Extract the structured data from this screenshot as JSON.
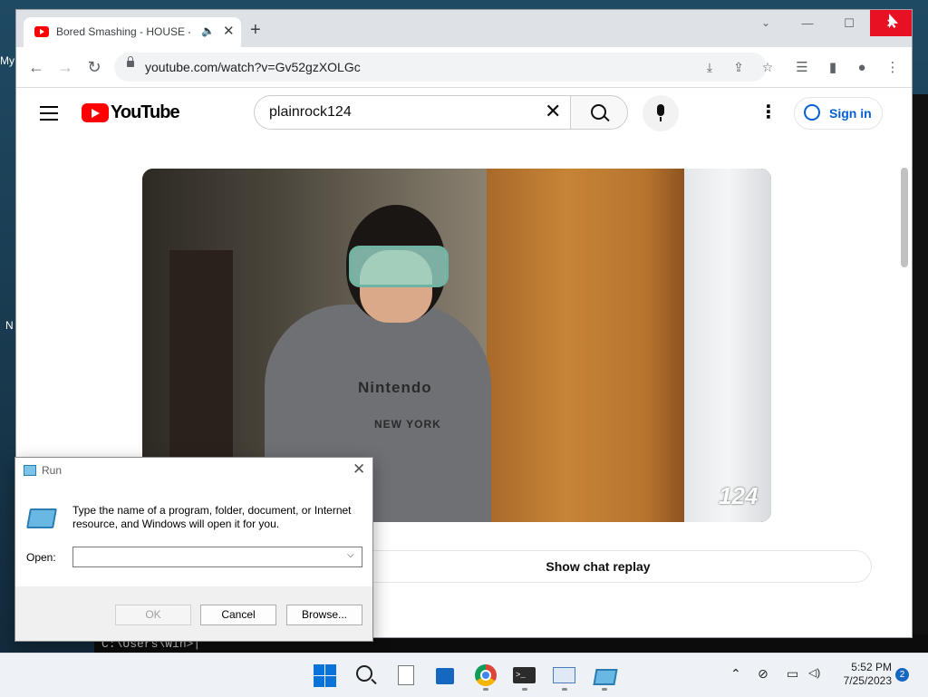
{
  "desktop": {
    "left_labels": [
      "My",
      "N"
    ],
    "terminal_text": "C:\\Users\\Win>|"
  },
  "browser": {
    "tab_title": "Bored Smashing - HOUSE - YouTube",
    "tab_audio_icon": "speaker-icon",
    "tab_close": "✕",
    "newtab": "+",
    "window_controls": {
      "tabsearch": "⌄",
      "minimize": "—",
      "maximize": "☐",
      "close": "✕"
    },
    "nav": {
      "back": "←",
      "forward": "→",
      "reload": "↻"
    },
    "url": "youtube.com/watch?v=Gv52gzXOLGc",
    "omnibox_icons": [
      "install-icon",
      "share-icon",
      "star-icon"
    ],
    "toolbar_icons": [
      "reading-list-icon",
      "side-panel-icon",
      "profile-icon",
      "menu-icon"
    ]
  },
  "youtube": {
    "logo_text": "YouTube",
    "search_value": "plainrock124",
    "clear_symbol": "✕",
    "kebab": "⋮",
    "signin_label": "Sign in",
    "video": {
      "shirt_text": "Nintendo",
      "shirt_sub": "NEW YORK",
      "watermark": "124"
    },
    "chat_replay_label": "Show chat replay"
  },
  "run_dialog": {
    "title": "Run",
    "close": "✕",
    "description": "Type the name of a program, folder, document, or Internet resource, and Windows will open it for you.",
    "open_label": "Open:",
    "open_value": "",
    "buttons": {
      "ok": "OK",
      "cancel": "Cancel",
      "browse": "Browse..."
    }
  },
  "taskbar": {
    "apps": [
      "start-icon",
      "search-icon",
      "file-icon",
      "store-icon",
      "chrome-icon",
      "terminal-icon",
      "performance-icon",
      "run-icon"
    ],
    "terminal_glyph": ">_",
    "tray": {
      "chevron": "⌃",
      "network": "⊘",
      "monitor": "▭",
      "volume": "🔊"
    },
    "time": "5:52 PM",
    "date": "7/25/2023",
    "notifications": "2"
  }
}
